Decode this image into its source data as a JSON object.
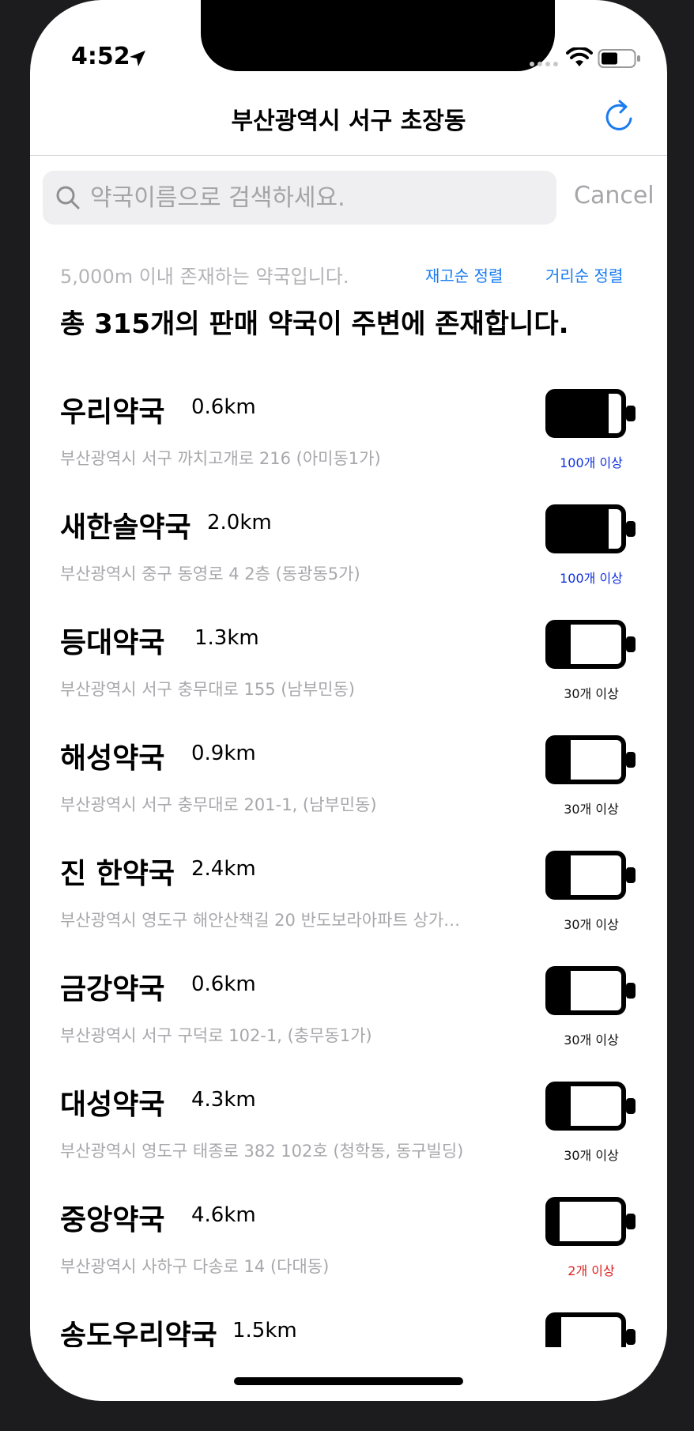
{
  "status_bar": {
    "time": "4:52"
  },
  "nav": {
    "title": "부산광역시 서구 초장동"
  },
  "search": {
    "placeholder": "약국이름으로 검색하세요.",
    "cancel_label": "Cancel"
  },
  "info": {
    "radius_note": "5,000m 이내 존재하는 약국입니다.",
    "sort_stock_label": "재고순 정렬",
    "sort_distance_label": "거리순 정렬",
    "total_text": "총 315개의 판매 약국이 주변에 존재합니다."
  },
  "colors": {
    "accent": "#1a7cf0",
    "stock_plenty": "#1030e0",
    "stock_some": "#111111",
    "stock_few": "#e02020"
  },
  "pharmacies": [
    {
      "name": "우리약국",
      "distance": "0.6km",
      "address": "부산광역시 서구 까치고개로 216 (아미동1가)",
      "stock_label": "100개 이상",
      "stock_level": "plenty"
    },
    {
      "name": "새한솔약국",
      "distance": "2.0km",
      "address": "부산광역시 중구 동영로 4 2층 (동광동5가)",
      "stock_label": "100개 이상",
      "stock_level": "plenty"
    },
    {
      "name": "등대약국",
      "distance": "1.3km",
      "address": "부산광역시 서구 충무대로 155 (남부민동)",
      "stock_label": "30개 이상",
      "stock_level": "some"
    },
    {
      "name": "해성약국",
      "distance": "0.9km",
      "address": "부산광역시 서구 충무대로 201-1, (남부민동)",
      "stock_label": "30개 이상",
      "stock_level": "some"
    },
    {
      "name": "진 한약국",
      "distance": "2.4km",
      "address": "부산광역시 영도구 해안산책길 20 반도보라아파트 상가…",
      "stock_label": "30개 이상",
      "stock_level": "some"
    },
    {
      "name": "금강약국",
      "distance": "0.6km",
      "address": "부산광역시 서구 구덕로 102-1, (충무동1가)",
      "stock_label": "30개 이상",
      "stock_level": "some"
    },
    {
      "name": "대성약국",
      "distance": "4.3km",
      "address": "부산광역시 영도구 태종로 382 102호 (청학동, 동구빌딩)",
      "stock_label": "30개 이상",
      "stock_level": "some"
    },
    {
      "name": "중앙약국",
      "distance": "4.6km",
      "address": "부산광역시 사하구 다송로 14 (다대동)",
      "stock_label": "2개 이상",
      "stock_level": "few"
    },
    {
      "name": "송도우리약국",
      "distance": "1.5km",
      "address": "",
      "stock_label": "",
      "stock_level": ""
    }
  ]
}
